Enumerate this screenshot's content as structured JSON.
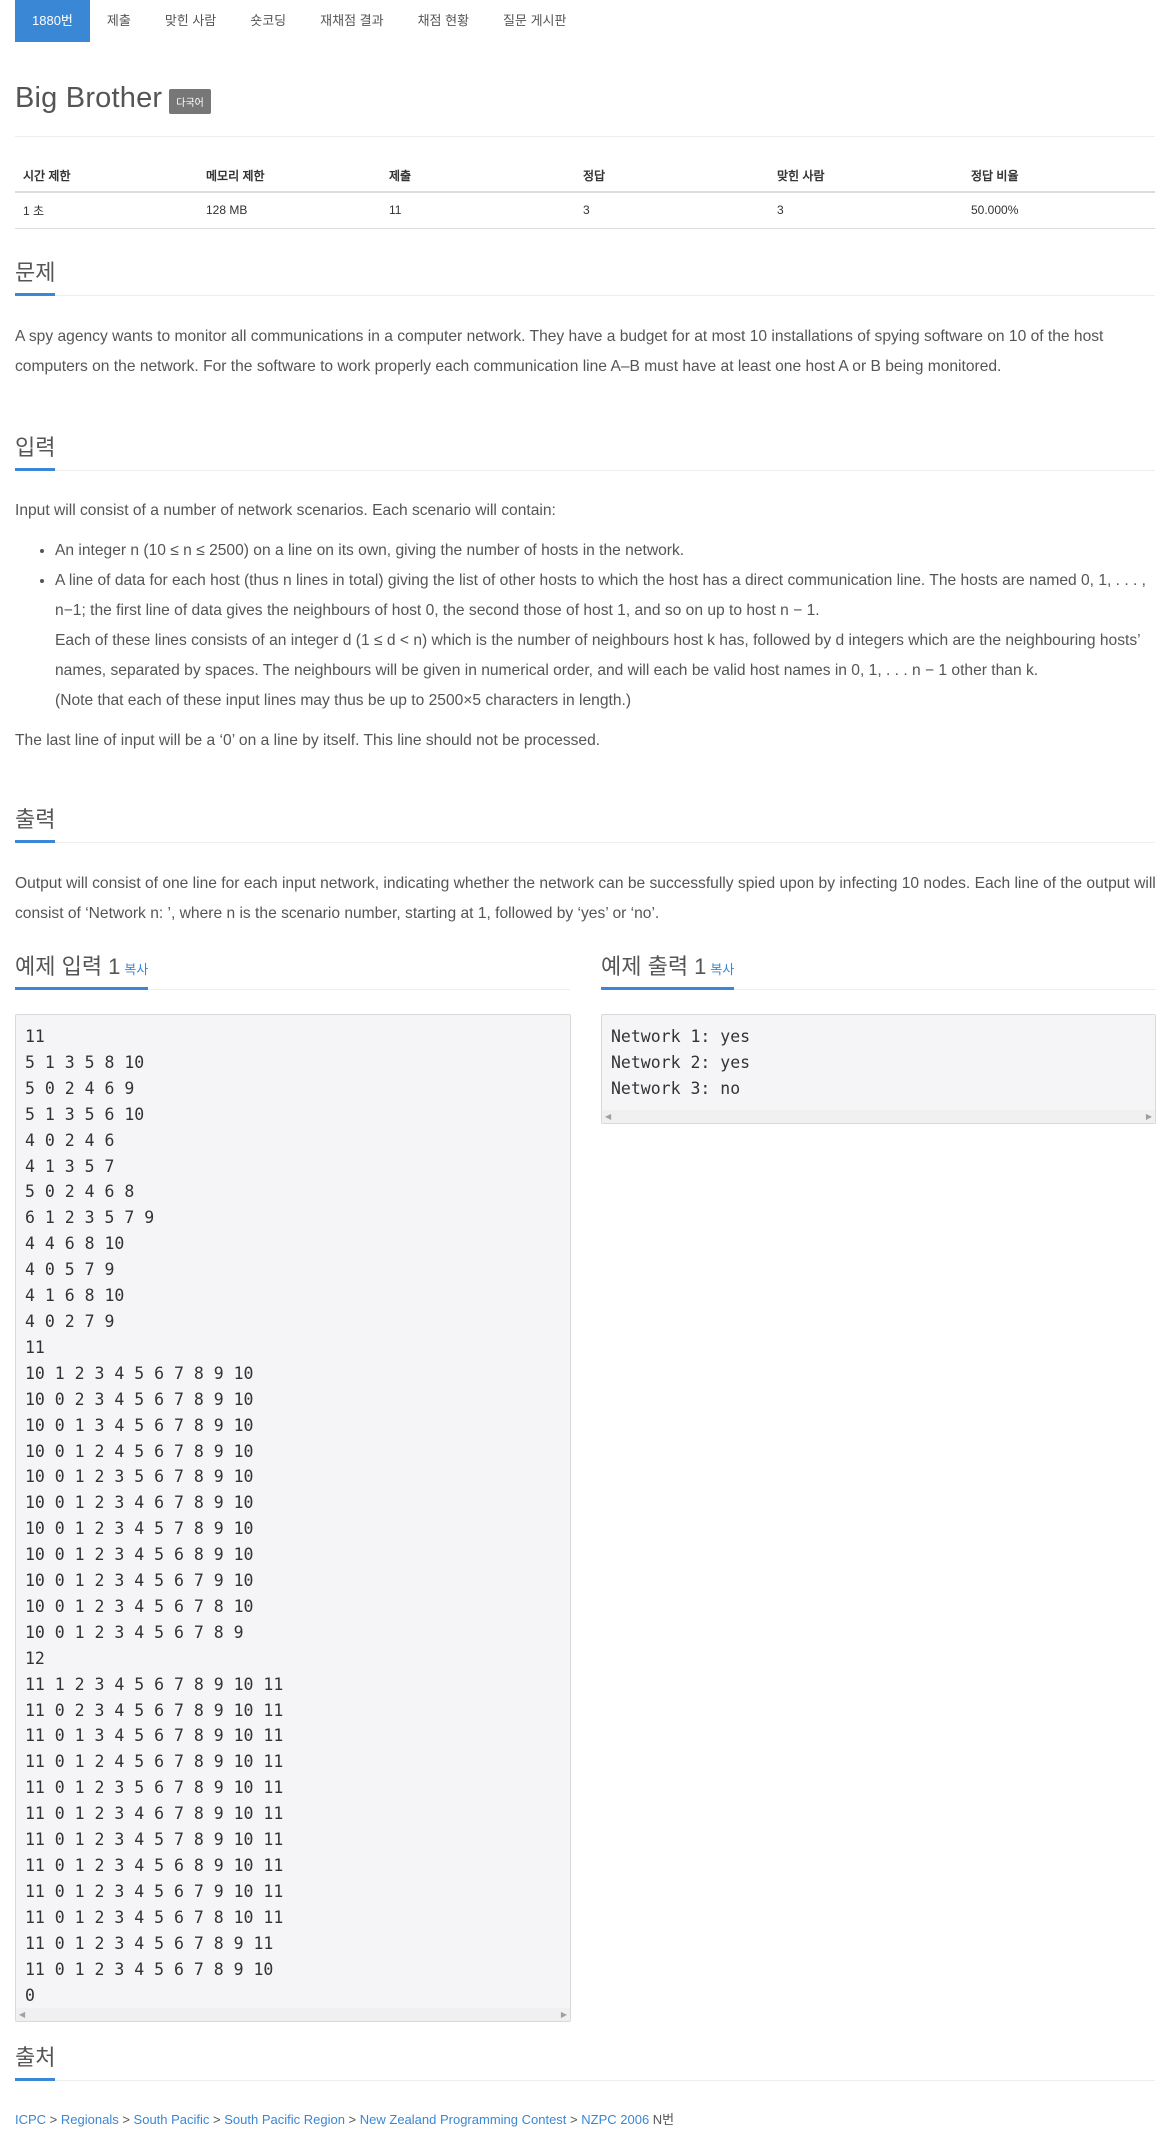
{
  "tabs": [
    {
      "label": "1880번",
      "active": true
    },
    {
      "label": "제출"
    },
    {
      "label": "맞힌 사람"
    },
    {
      "label": "숏코딩"
    },
    {
      "label": "재채점 결과"
    },
    {
      "label": "채점 현황"
    },
    {
      "label": "질문 게시판"
    }
  ],
  "problem": {
    "title": "Big Brother",
    "badge": "다국어"
  },
  "info": {
    "headers": [
      "시간 제한",
      "메모리 제한",
      "제출",
      "정답",
      "맞힌 사람",
      "정답 비율"
    ],
    "values": [
      "1 초",
      "128 MB",
      "11",
      "3",
      "3",
      "50.000%"
    ]
  },
  "sections": {
    "description": {
      "title": "문제",
      "text": "A spy agency wants to monitor all communications in a computer network. They have a budget for at most 10 installations of spying software on 10 of the host computers on the network. For the software to work properly each communication line A–B must have at least one host A or B being monitored."
    },
    "input": {
      "title": "입력",
      "intro": "Input will consist of a number of network scenarios. Each scenario will contain:",
      "bullet1": "An integer n (10 ≤ n ≤ 2500) on a line on its own, giving the number of hosts in the network.",
      "bullet2_a": "A line of data for each host (thus n lines in total) giving the list of other hosts to which the host has a direct communication line. The hosts are named 0, 1, . . . , n−1; the first line of data gives the neighbours of host 0, the second those of host 1, and so on up to host n − 1.",
      "bullet2_b": "Each of these lines consists of an integer d (1 ≤ d < n) which is the number of neighbours host k has, followed by d integers which are the neighbouring hosts’ names, separated by spaces. The neighbours will be given in numerical order, and will each be valid host names in 0, 1, . . . n − 1 other than k.",
      "bullet2_c": "(Note that each of these input lines may thus be up to 2500×5 characters in length.)",
      "outro": "The last line of input will be a ‘0’ on a line by itself. This line should not be processed."
    },
    "output": {
      "title": "출력",
      "text": "Output will consist of one line for each input network, indicating whether the network can be successfully spied upon by infecting 10 nodes. Each line of the output will consist of ‘Network n: ’, where n is the scenario number, starting at 1, followed by ‘yes’ or ‘no’."
    },
    "source": {
      "title": "출처"
    }
  },
  "samples": {
    "input_title": "예제 입력 1",
    "output_title": "예제 출력 1",
    "copy_label": "복사",
    "input_text": "11\n5 1 3 5 8 10\n5 0 2 4 6 9\n5 1 3 5 6 10\n4 0 2 4 6\n4 1 3 5 7\n5 0 2 4 6 8\n6 1 2 3 5 7 9\n4 4 6 8 10\n4 0 5 7 9\n4 1 6 8 10\n4 0 2 7 9\n11\n10 1 2 3 4 5 6 7 8 9 10\n10 0 2 3 4 5 6 7 8 9 10\n10 0 1 3 4 5 6 7 8 9 10\n10 0 1 2 4 5 6 7 8 9 10\n10 0 1 2 3 5 6 7 8 9 10\n10 0 1 2 3 4 6 7 8 9 10\n10 0 1 2 3 4 5 7 8 9 10\n10 0 1 2 3 4 5 6 8 9 10\n10 0 1 2 3 4 5 6 7 9 10\n10 0 1 2 3 4 5 6 7 8 10\n10 0 1 2 3 4 5 6 7 8 9\n12\n11 1 2 3 4 5 6 7 8 9 10 11\n11 0 2 3 4 5 6 7 8 9 10 11\n11 0 1 3 4 5 6 7 8 9 10 11\n11 0 1 2 4 5 6 7 8 9 10 11\n11 0 1 2 3 5 6 7 8 9 10 11\n11 0 1 2 3 4 6 7 8 9 10 11\n11 0 1 2 3 4 5 7 8 9 10 11\n11 0 1 2 3 4 5 6 8 9 10 11\n11 0 1 2 3 4 5 6 7 9 10 11\n11 0 1 2 3 4 5 6 7 8 10 11\n11 0 1 2 3 4 5 6 7 8 9 11\n11 0 1 2 3 4 5 6 7 8 9 10\n0",
    "output_text": "Network 1: yes\nNetwork 2: yes\nNetwork 3: no"
  },
  "breadcrumb": {
    "items": [
      "ICPC",
      "Regionals",
      "South Pacific",
      "South Pacific Region",
      "New Zealand Programming Contest",
      "NZPC 2006"
    ],
    "separator": " > ",
    "suffix": "N번"
  },
  "colors": {
    "accent": "#3a87d6",
    "badge": "#777777",
    "text": "#555555",
    "sample_bg": "#f5f5f7"
  }
}
